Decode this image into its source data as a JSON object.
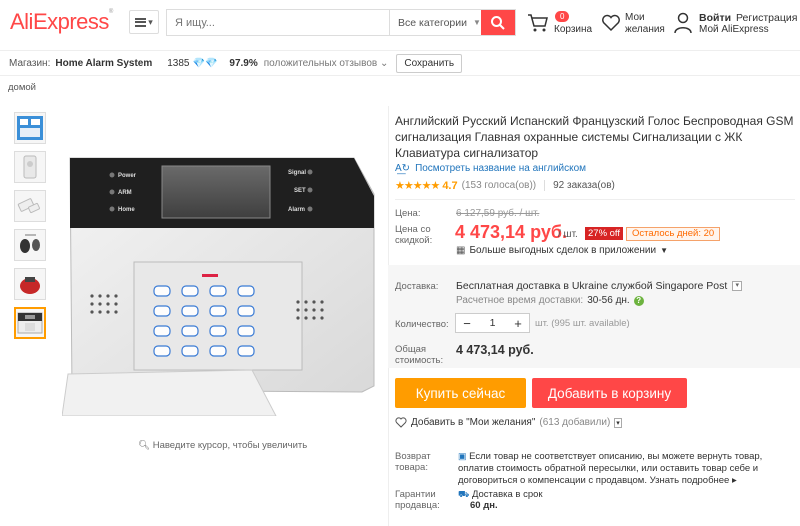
{
  "header": {
    "logo": "AliExpress",
    "search_placeholder": "Я ищу...",
    "search_category": "Все категории",
    "cart_count": "0",
    "cart_label": "Корзина",
    "wishlist_label": "Мои желания",
    "login": "Войти",
    "register": "Регистрация",
    "my_aliexpress": "Мой AliExpress"
  },
  "store": {
    "label": "Магазин:",
    "name": "Home Alarm System",
    "score": "1385",
    "positive_pct": "97.9%",
    "positive_label": "положительных отзывов",
    "save_label": "Сохранить"
  },
  "breadcrumb": "домой",
  "gallery": {
    "zoom_hint": "Наведите курсор, чтобы увеличить",
    "panel_labels": [
      "Power",
      "ARM",
      "Home",
      "Signal",
      "SET",
      "Alarm"
    ]
  },
  "product": {
    "title": "Английский Русский Испанский Французский Голос Беспроводная GSM сигнализация Главная охранные системы Сигнализации с ЖК Клавиатура сигнализатор",
    "translate_link": "Посмотреть название на английском",
    "rating": "4.7",
    "votes": "(153 голоса(ов))",
    "orders": "92 заказа(ов)",
    "price_label": "Цена:",
    "old_price": "6 127,59 руб. / шт.",
    "discount_price_label": "Цена со скидкой:",
    "new_price": "4 473,14 руб.",
    "per_unit": "/ шт.",
    "discount_badge": "27% off",
    "days_left": "Осталось дней: 20",
    "app_deals": "Больше выгодных сделок в приложении",
    "shipping_label": "Доставка:",
    "shipping_text": "Бесплатная доставка в Ukraine службой Singapore Post",
    "delivery_time_label": "Расчетное время доставки:",
    "delivery_time": "30-56 дн.",
    "qty_label": "Количество:",
    "qty_value": "1",
    "qty_available": "шт. (995 шт. available)",
    "total_label": "Общая стоимость:",
    "total_price": "4 473,14 руб.",
    "buy_now": "Купить сейчас",
    "add_to_cart": "Добавить в корзину",
    "add_wish": "Добавить в \"Мои желания\"",
    "wish_count": "(613 добавили)",
    "return_label": "Возврат товара:",
    "return_text": "Если товар не соответствует описанию, вы можете вернуть товар, оплатив стоимость обратной пересылки, или оставить товар себе и договориться о компенсации с продавцом.",
    "return_more": "Узнать подробнее",
    "guarantee_label": "Гарантии продавца:",
    "guarantee_text": "Доставка в срок",
    "guarantee_days": "60 дн."
  },
  "colors": {
    "brand": "#ff4747",
    "buy": "#ff9c00",
    "link": "#2175bc"
  }
}
